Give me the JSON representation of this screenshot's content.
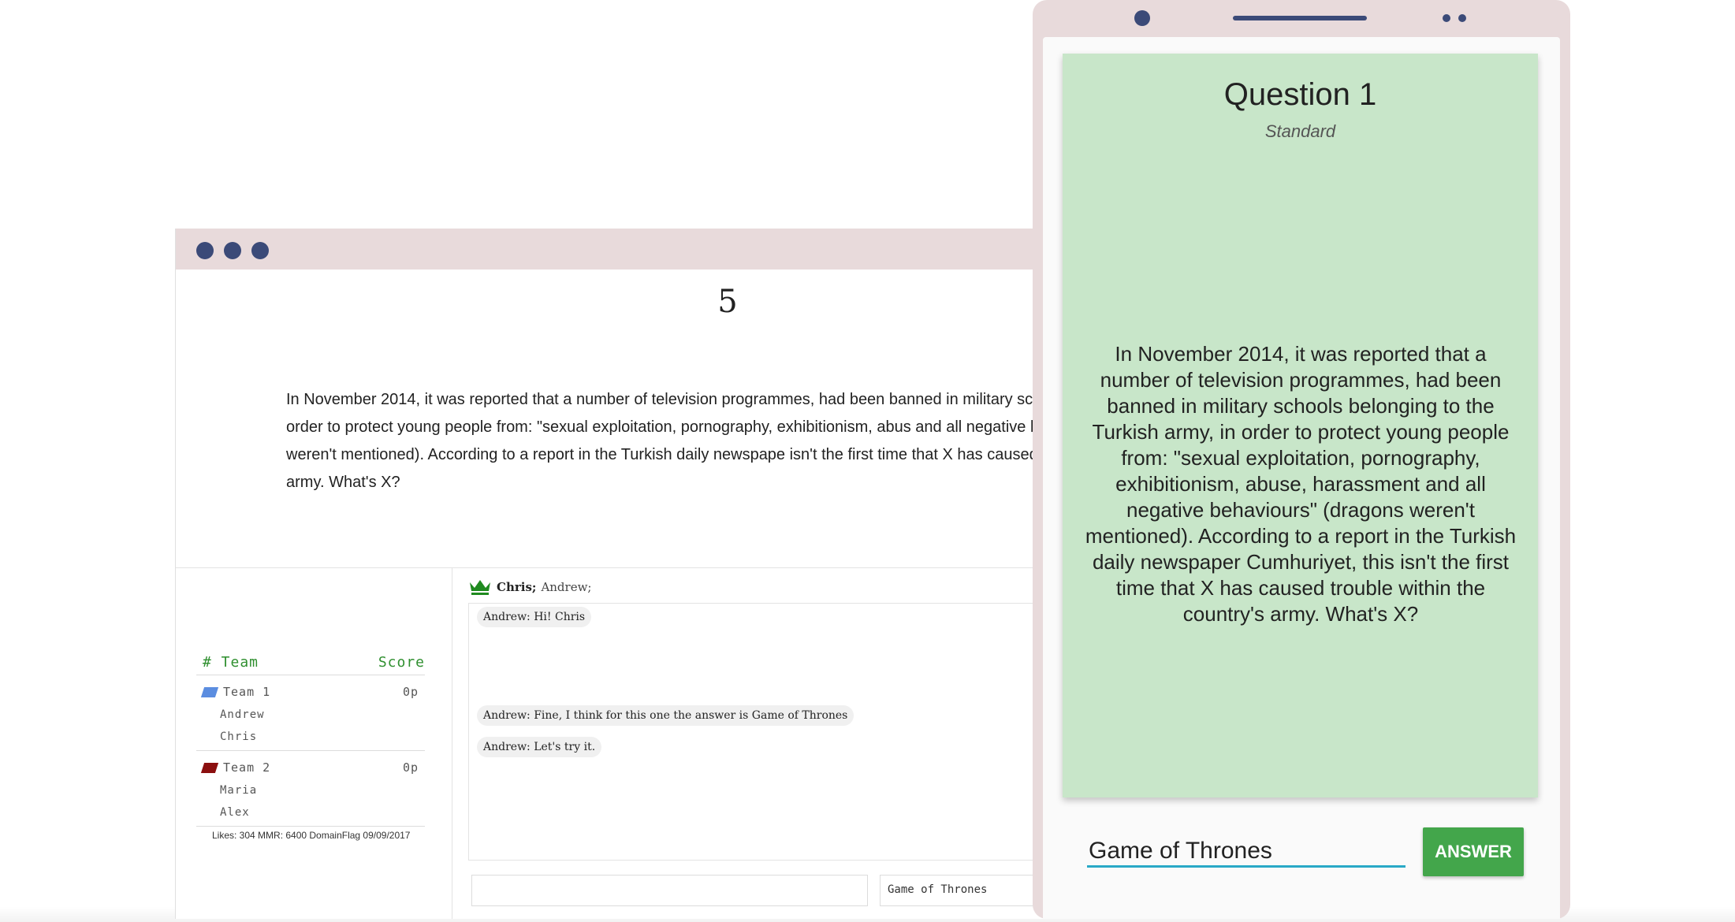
{
  "desktop": {
    "question_number": "5",
    "question_text": "In November 2014, it was reported that a number of television programmes, had been banned in military schoo the Turkish army, in order to protect young people from: \"sexual exploitation, pornography, exhibitionism, abus and all negative behaviours\" (dragons weren't mentioned). According to a report in the Turkish daily newspape isn't the first time that X has caused trouble within the country's army. What's X?",
    "scoreboard": {
      "header_team": "# Team",
      "header_score": "Score",
      "teams": [
        {
          "name": "Team 1",
          "score": "0p",
          "flag_color": "#5b8de0",
          "members": [
            "Andrew",
            "Chris"
          ]
        },
        {
          "name": "Team 2",
          "score": "0p",
          "flag_color": "#8b0f0f",
          "members": [
            "Maria",
            "Alex"
          ]
        }
      ],
      "footer": "Likes: 304 MMR: 6400 DomainFlag 09/09/2017"
    },
    "chat": {
      "leader": "Chris;",
      "others": "Andrew;",
      "messages": [
        "Andrew: Hi! Chris",
        "Andrew: Fine, I think for this one the answer is Game of Thrones",
        "Andrew: Let's try it."
      ],
      "chat_input_value": "",
      "answer_input_value": "Game of Thrones"
    }
  },
  "phone": {
    "title": "Question 1",
    "subtitle": "Standard",
    "question_text": "In November 2014, it was reported that a number of television programmes, had been banned in military schools belonging to the Turkish army, in order to protect young people from: \"sexual exploitation, pornography, exhibitionism, abuse, harassment and all negative behaviours\" (dragons weren't mentioned). According to a report in the Turkish daily newspaper Cumhuriyet, this isn't the first time that X has caused trouble within the country's army. What's X?",
    "answer_value": "Game of Thrones",
    "answer_button": "ANSWER",
    "card_color": "#c8e6c9",
    "button_color": "#43a64b"
  },
  "icons": {
    "window_controls": "three-dots",
    "leader_icon": "crown-icon"
  }
}
